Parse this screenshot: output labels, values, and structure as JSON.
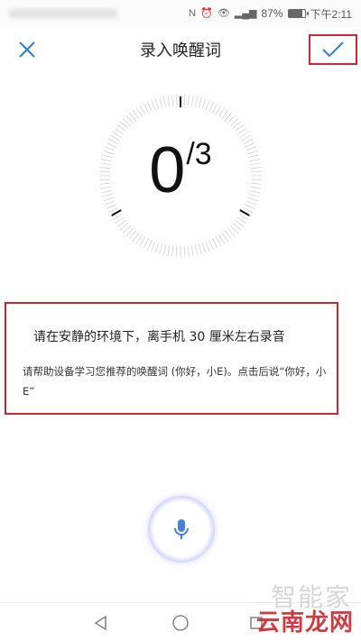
{
  "status_bar": {
    "battery_percent": "87%",
    "battery_level": 87,
    "time": "下午2:11",
    "icons": [
      "nfc-icon",
      "alarm-icon",
      "eye-icon",
      "signal-icon",
      "battery-icon"
    ]
  },
  "header": {
    "title": "录入唤醒词",
    "close_icon": "close-icon",
    "confirm_icon": "check-icon"
  },
  "counter": {
    "current": "0",
    "total": "/3"
  },
  "instructions": {
    "main": "请在安静的环境下，离手机 30 厘米左右录音",
    "sub": "请帮助设备学习您推荐的唤醒词 (你好，小E)。点击后说“你好，小E”"
  },
  "mic": {
    "icon": "microphone-icon"
  },
  "nav": {
    "back_icon": "back-triangle-icon",
    "home_icon": "home-circle-icon",
    "recent_icon": "recent-square-icon"
  },
  "watermark": {
    "text": "云南龙网",
    "ghost_text": "智能家"
  },
  "colors": {
    "accent": "#2f7fd6",
    "highlight_border": "#c8292e",
    "tick": "#d9d9d9"
  }
}
